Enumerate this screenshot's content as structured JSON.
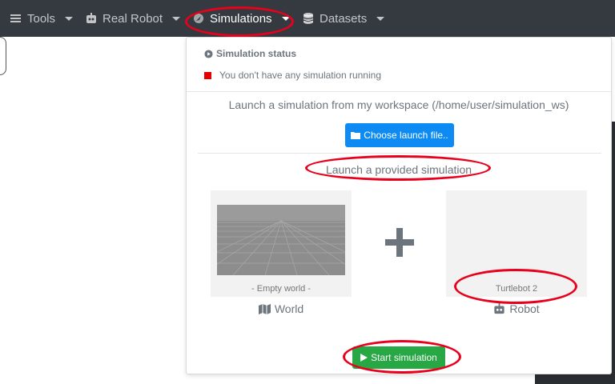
{
  "navbar": {
    "items": [
      {
        "label": "Tools",
        "icon": "hamburger-icon"
      },
      {
        "label": "Real Robot",
        "icon": "robot-icon"
      },
      {
        "label": "Simulations",
        "icon": "rocket-icon"
      },
      {
        "label": "Datasets",
        "icon": "database-icon"
      }
    ]
  },
  "dropdown": {
    "status_title": "Simulation status",
    "status_message": "You don't have any simulation running",
    "workspace_text": "Launch a simulation from my workspace (/home/user/simulation_ws)",
    "choose_button": "Choose launch file..",
    "provided_text": "Launch a provided simulation",
    "world_card": {
      "caption": "- Empty world -",
      "label": "World"
    },
    "robot_card": {
      "caption": "Turtlebot 2",
      "label": "Robot"
    },
    "start_button": "Start simulation"
  },
  "colors": {
    "navbar": "#343a40",
    "primary_button": "#0d8bf2",
    "success_button": "#28a745",
    "status_indicator": "#e60000",
    "annotation": "#e8001c"
  }
}
